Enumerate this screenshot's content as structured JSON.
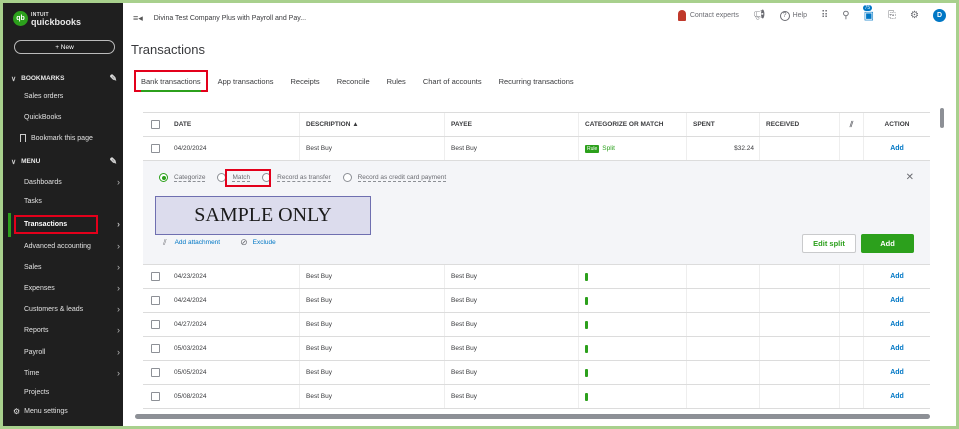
{
  "app": {
    "logo_top": "INTUIT",
    "logo_bottom": "quickbooks",
    "logo_badge": "qb",
    "company_name": "Divina Test Company Plus with Payroll and Pay..."
  },
  "sidebar": {
    "new_button": "+  New",
    "bookmarks_label": "BOOKMARKS",
    "bookmark_items": [
      "Sales orders",
      "QuickBooks"
    ],
    "bookmark_page": "Bookmark this page",
    "menu_label": "MENU",
    "menu_items": [
      {
        "label": "Dashboards",
        "arrow": true
      },
      {
        "label": "Tasks",
        "arrow": false
      },
      {
        "label": "Transactions",
        "arrow": true
      },
      {
        "label": "Advanced accounting",
        "arrow": true
      },
      {
        "label": "Sales",
        "arrow": true
      },
      {
        "label": "Expenses",
        "arrow": true
      },
      {
        "label": "Customers & leads",
        "arrow": true
      },
      {
        "label": "Reports",
        "arrow": true
      },
      {
        "label": "Payroll",
        "arrow": true
      },
      {
        "label": "Time",
        "arrow": true
      },
      {
        "label": "Projects",
        "arrow": false
      }
    ],
    "menu_settings": "Menu settings"
  },
  "topbar": {
    "contact_experts": "Contact experts",
    "help": "Help",
    "notification_count": "75",
    "user_initial": "D"
  },
  "page": {
    "title": "Transactions",
    "tabs": [
      "Bank transactions",
      "App transactions",
      "Receipts",
      "Reconcile",
      "Rules",
      "Chart of accounts",
      "Recurring transactions"
    ]
  },
  "table": {
    "headers": {
      "date": "DATE",
      "description": "DESCRIPTION ▲",
      "payee": "PAYEE",
      "category": "CATEGORIZE OR MATCH",
      "spent": "SPENT",
      "received": "RECEIVED",
      "action": "ACTION"
    },
    "first_row": {
      "date": "04/20/2024",
      "description": "Best Buy",
      "payee": "Best Buy",
      "rule_badge": "Rule",
      "category": "Split",
      "spent": "$32.24",
      "action": "Add"
    },
    "rows": [
      {
        "date": "04/23/2024",
        "description": "Best Buy",
        "payee": "Best Buy",
        "action": "Add"
      },
      {
        "date": "04/24/2024",
        "description": "Best Buy",
        "payee": "Best Buy",
        "action": "Add"
      },
      {
        "date": "04/27/2024",
        "description": "Best Buy",
        "payee": "Best Buy",
        "action": "Add"
      },
      {
        "date": "05/03/2024",
        "description": "Best Buy",
        "payee": "Best Buy",
        "action": "Add"
      },
      {
        "date": "05/05/2024",
        "description": "Best Buy",
        "payee": "Best Buy",
        "action": "Add"
      },
      {
        "date": "05/08/2024",
        "description": "Best Buy",
        "payee": "Best Buy",
        "action": "Add"
      }
    ]
  },
  "expanded": {
    "options": [
      "Categorize",
      "Match",
      "Record as transfer",
      "Record as credit card payment"
    ],
    "selected": "Categorize",
    "sample_text": "SAMPLE ONLY",
    "add_attachment": "Add attachment",
    "exclude": "Exclude",
    "edit_split": "Edit split",
    "add": "Add"
  }
}
